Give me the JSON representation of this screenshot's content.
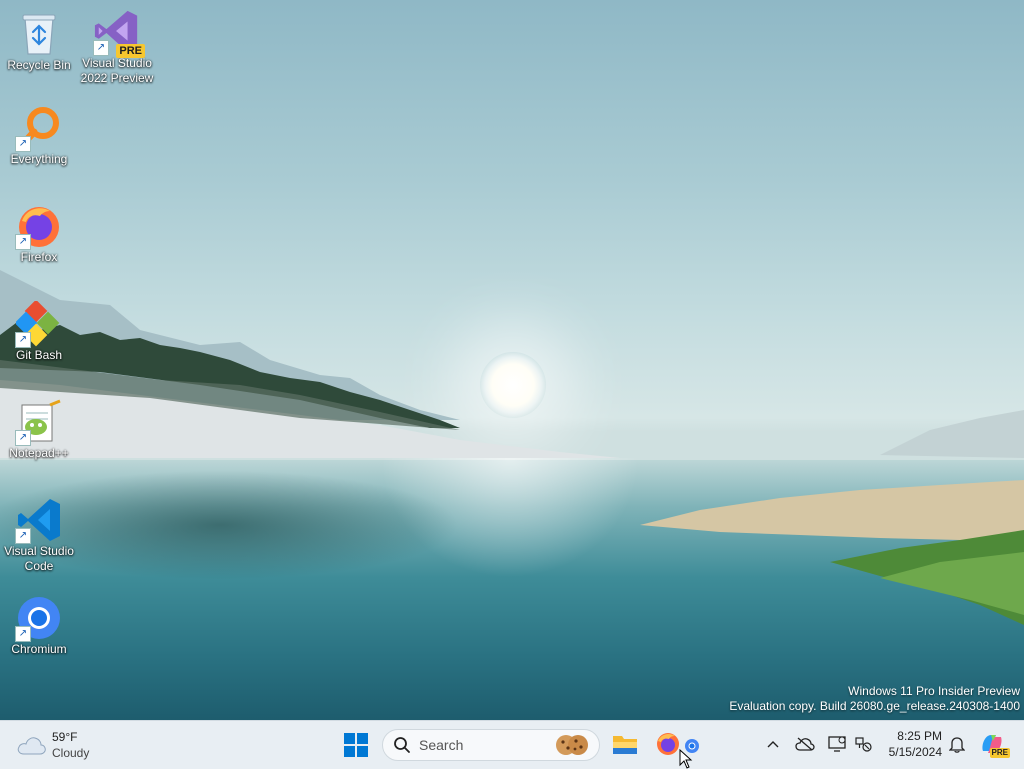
{
  "desktop_icons": [
    {
      "label": "Recycle Bin",
      "icon": "recycle-bin-icon"
    },
    {
      "label": "Visual Studio 2022 Preview",
      "icon": "visual-studio-preview-icon",
      "badge": "PRE"
    },
    {
      "label": "Everything",
      "icon": "everything-search-icon"
    },
    {
      "label": "Firefox",
      "icon": "firefox-icon"
    },
    {
      "label": "Git Bash",
      "icon": "git-bash-icon"
    },
    {
      "label": "Notepad++",
      "icon": "notepad-plus-plus-icon"
    },
    {
      "label": "Visual Studio Code",
      "icon": "vscode-icon"
    },
    {
      "label": "Chromium",
      "icon": "chromium-icon"
    }
  ],
  "watermark": {
    "line1": "Windows 11 Pro Insider Preview",
    "line2": "Evaluation copy. Build 26080.ge_release.240308-1400"
  },
  "taskbar": {
    "weather": {
      "temp": "59°F",
      "condition": "Cloudy",
      "icon": "cloudy-weather-icon"
    },
    "start_icon": "windows-start-icon",
    "search": {
      "placeholder": "Search",
      "icon": "search-icon"
    },
    "pinned": [
      {
        "name": "file-explorer-icon"
      },
      {
        "name": "firefox-taskbar-icon"
      },
      {
        "name": "chromium-taskbar-icon"
      }
    ],
    "tray": {
      "icons": [
        "chevron-up-icon",
        "onedrive-icon",
        "display-icon",
        "network-icon",
        "notification-bell-icon",
        "copilot-icon"
      ],
      "copilot_badge": "PRE"
    },
    "clock": {
      "time": "8:25 PM",
      "date": "5/15/2024"
    }
  },
  "colors": {
    "taskbar_bg": "#e8eef3",
    "accent": "#0078d4"
  }
}
